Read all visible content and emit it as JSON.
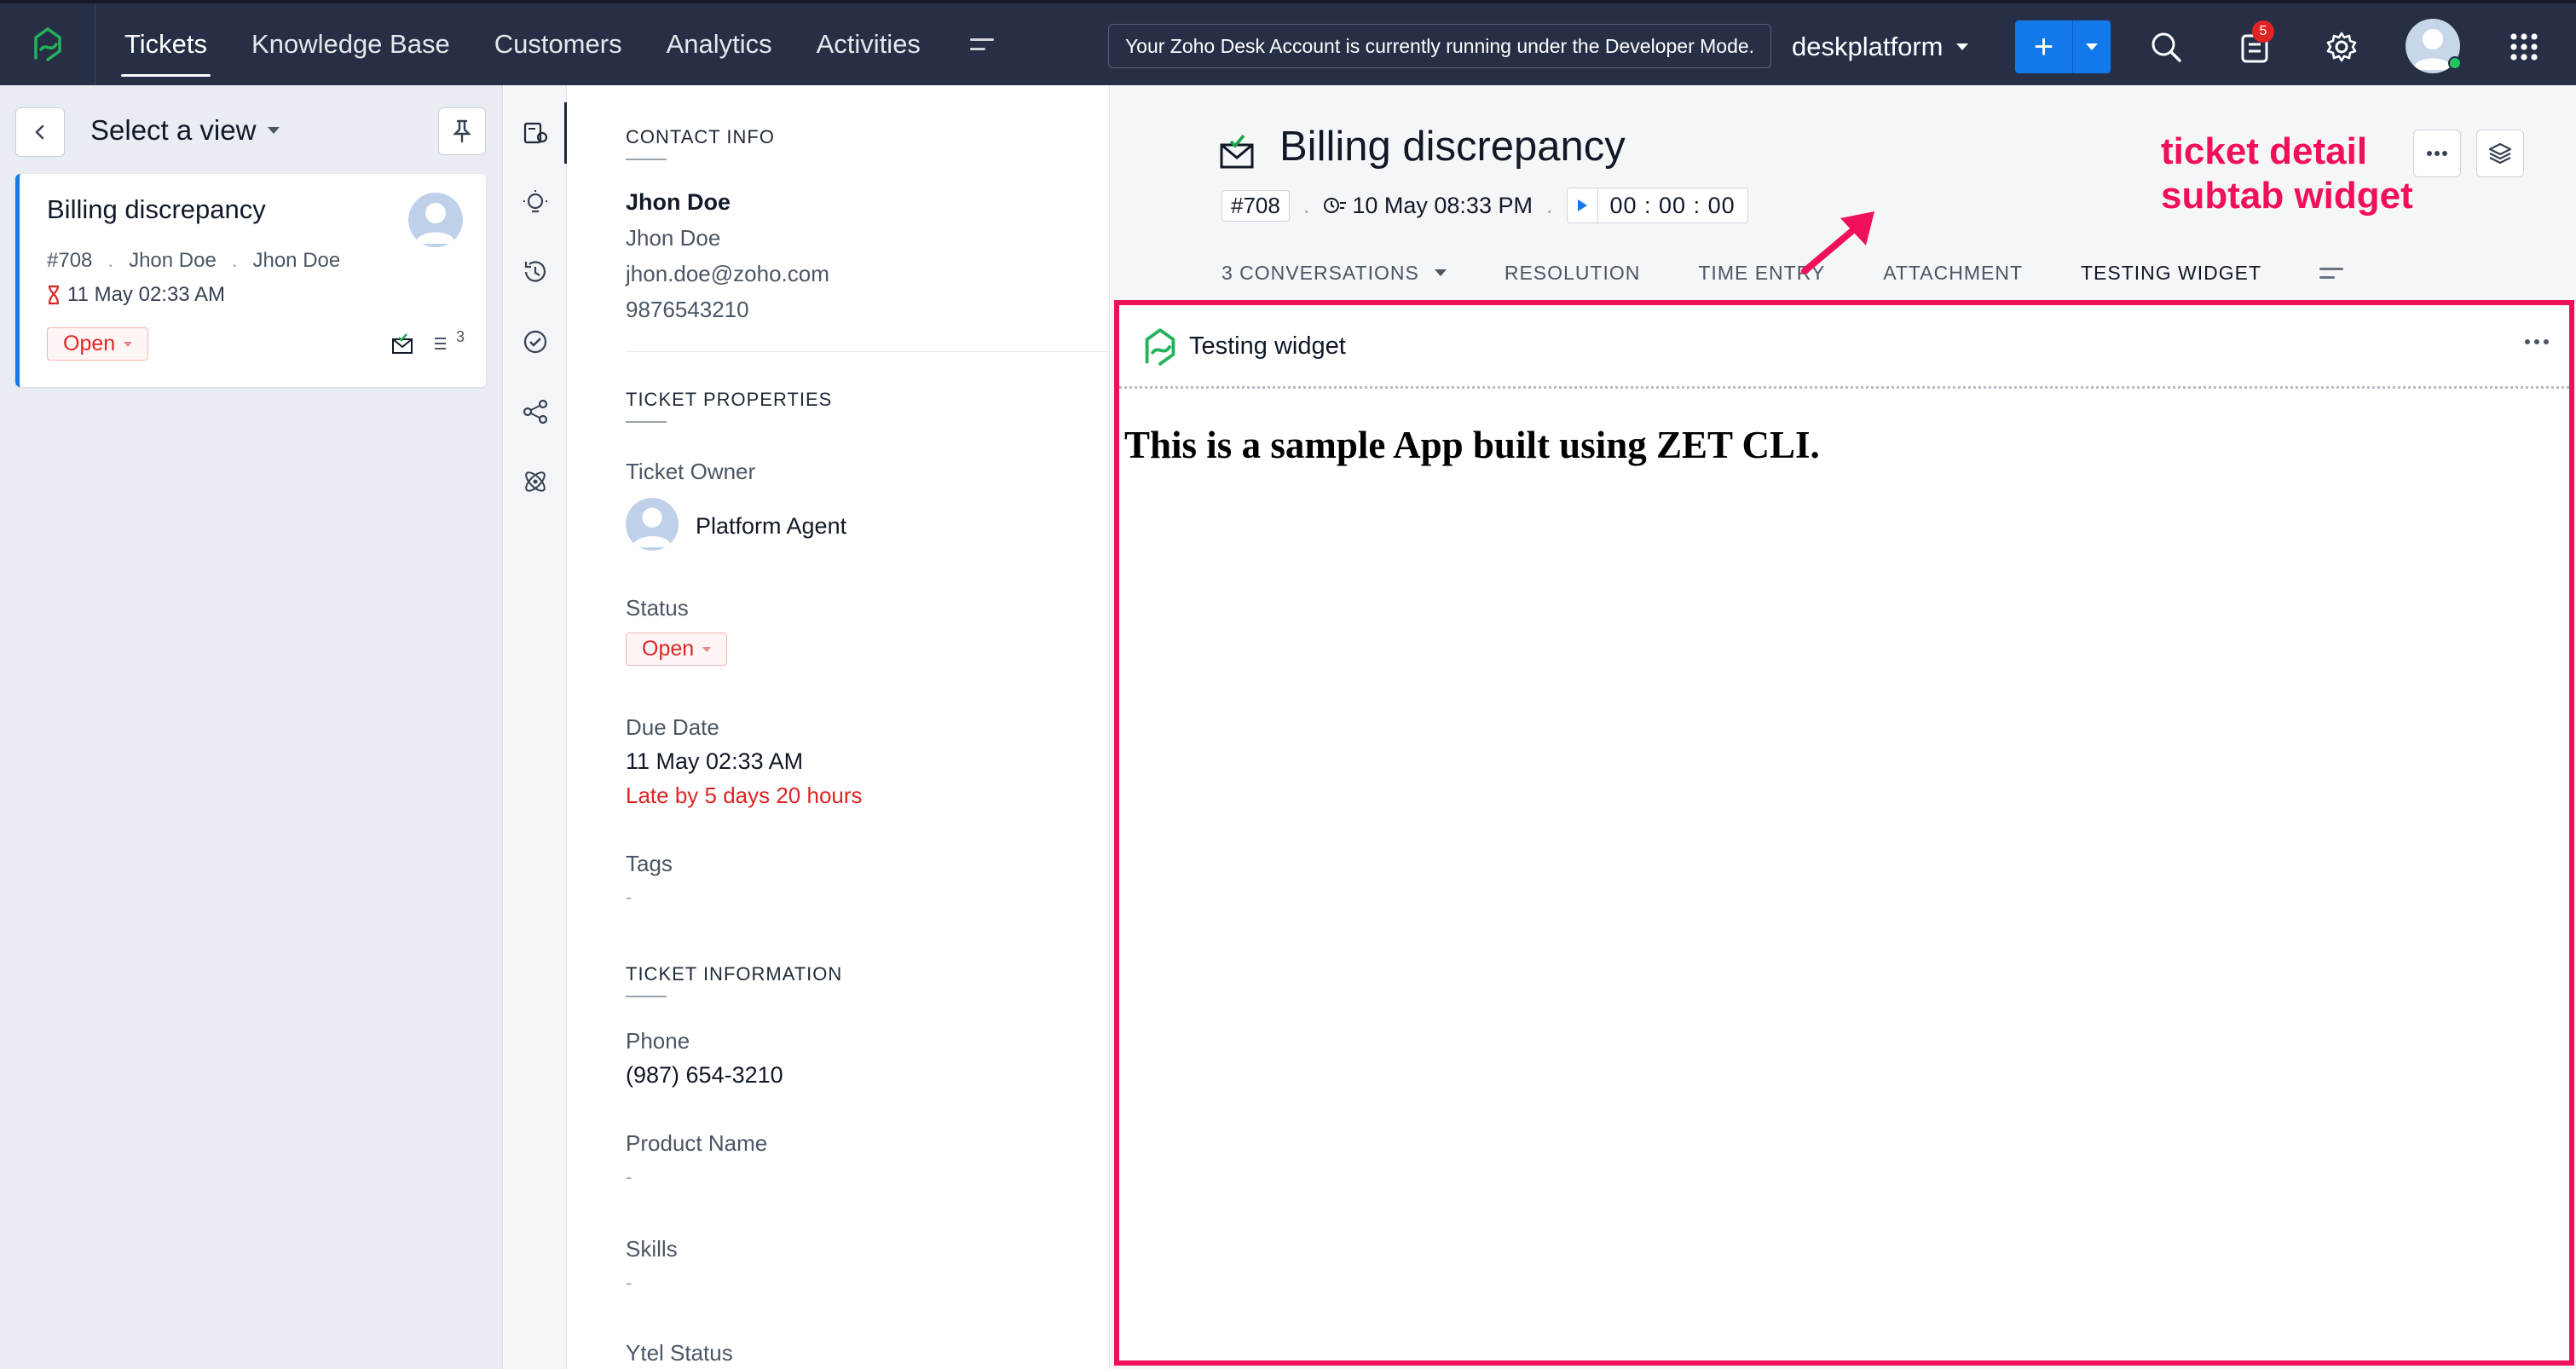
{
  "nav": {
    "tabs": [
      {
        "label": "Tickets",
        "active": true
      },
      {
        "label": "Knowledge Base",
        "active": false
      },
      {
        "label": "Customers",
        "active": false
      },
      {
        "label": "Analytics",
        "active": false
      },
      {
        "label": "Activities",
        "active": false
      }
    ],
    "dev_mode_notice": "Your Zoho Desk Account is currently running under the Developer Mode.",
    "portal_name": "deskplatform",
    "notification_count": "5",
    "icons": [
      "zoho-desk-logo-icon",
      "more-menu-icon",
      "plus-icon",
      "search-icon",
      "notifications-icon",
      "settings-icon",
      "apps-grid-icon"
    ]
  },
  "left_panel": {
    "view_title": "Select a view",
    "ticket_card": {
      "subject": "Billing discrepancy",
      "ticket_number": "#708",
      "contact": "Jhon Doe",
      "account": "Jhon Doe",
      "due_date": "11 May 02:33 AM",
      "status": "Open",
      "thread_count": "3"
    }
  },
  "properties": {
    "contact_info_title": "CONTACT INFO",
    "contact_name": "Jhon Doe",
    "account_name": "Jhon Doe",
    "email": "jhon.doe@zoho.com",
    "phone_contact": "9876543210",
    "ticket_properties_title": "TICKET PROPERTIES",
    "owner_label": "Ticket Owner",
    "owner_value": "Platform Agent",
    "status_label": "Status",
    "status_value": "Open",
    "due_label": "Due Date",
    "due_value": "11 May 02:33 AM",
    "due_late": "Late by 5 days 20 hours",
    "tags_label": "Tags",
    "tags_value": "-",
    "ticket_info_title": "TICKET INFORMATION",
    "phone_label": "Phone",
    "phone_value": "(987) 654-3210",
    "product_label": "Product Name",
    "product_value": "-",
    "skills_label": "Skills",
    "skills_value": "-",
    "ytel_label": "Ytel Status"
  },
  "detail": {
    "title": "Billing discrepancy",
    "ticket_number": "#708",
    "created": "10 May 08:33 PM",
    "timer": "00 : 00 : 00",
    "tabs": [
      {
        "label": "3 CONVERSATIONS",
        "active": false
      },
      {
        "label": "RESOLUTION",
        "active": false
      },
      {
        "label": "TIME ENTRY",
        "active": false
      },
      {
        "label": "ATTACHMENT",
        "active": false
      },
      {
        "label": "TESTING WIDGET",
        "active": true
      }
    ],
    "annotation": [
      "ticket detail",
      "subtab widget"
    ],
    "widget_title": "Testing widget",
    "widget_body": "This is a sample App built using ZET CLI."
  },
  "colors": {
    "topbar": "#262f45",
    "accent_blue": "#1279ea",
    "annotation_pink": "#f0105a",
    "status_red": "#dc2626"
  }
}
